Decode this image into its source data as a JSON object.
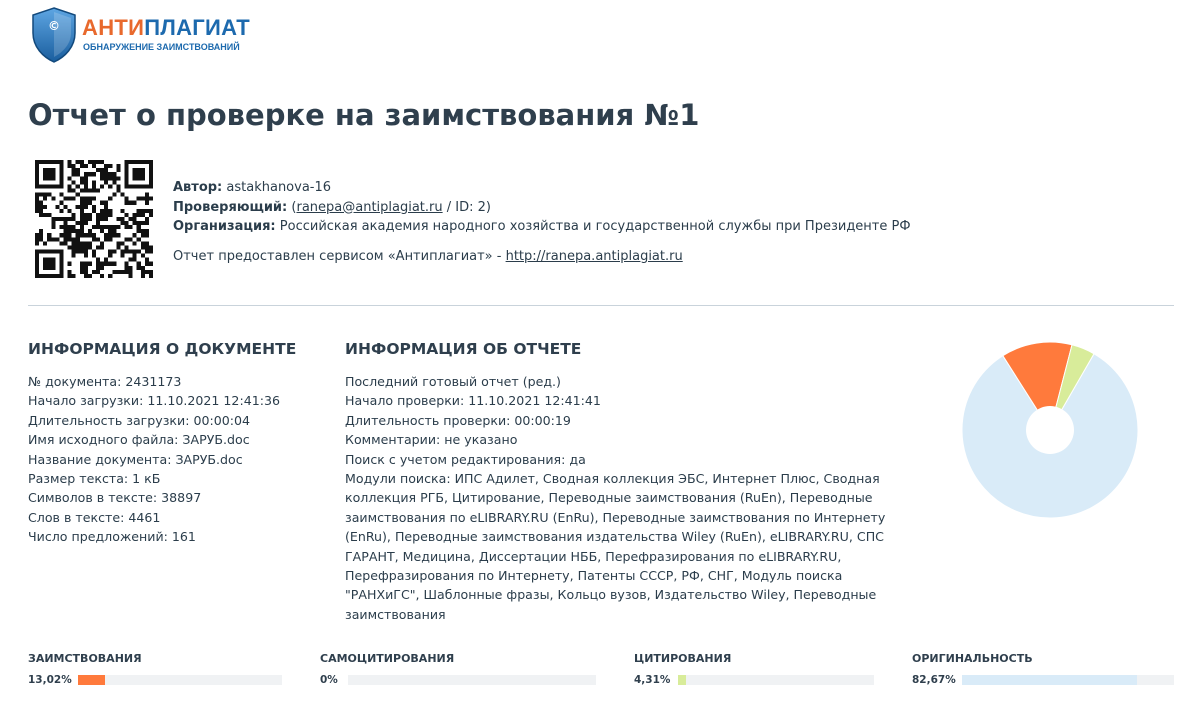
{
  "logo": {
    "brand_part1": "АНТИ",
    "brand_part2": "ПЛАГИАТ",
    "tagline": "ОБНАРУЖЕНИЕ ЗАИМСТВОВАНИЙ",
    "symbol": "©"
  },
  "title": "Отчет о проверке на заимствования №1",
  "meta": {
    "author_label": "Автор:",
    "author_value": "astakhanova-16",
    "checker_label": "Проверяющий:",
    "checker_open": "(",
    "checker_email": "ranepa@antiplagiat.ru",
    "checker_rest": " / ID: 2)",
    "org_label": "Организация:",
    "org_value": "Российская академия народного хозяйства и государственной службы при Президенте РФ",
    "provided_text": "Отчет предоставлен сервисом «Антиплагиат» - ",
    "provided_link": "http://ranepa.antiplagiat.ru"
  },
  "doc_info": {
    "title": "ИНФОРМАЦИЯ О ДОКУМЕНТЕ",
    "lines": [
      "№ документа: 2431173",
      "Начало загрузки: 11.10.2021 12:41:36",
      "Длительность загрузки: 00:00:04",
      "Имя исходного файла: ЗАРУБ.doc",
      "Название документа: ЗАРУБ.doc",
      "Размер текста: 1 кБ",
      "Символов в тексте: 38897",
      "Слов в тексте: 4461",
      "Число предложений: 161"
    ]
  },
  "report_info": {
    "title": "ИНФОРМАЦИЯ ОБ ОТЧЕТЕ",
    "lines": [
      "Последний готовый отчет (ред.)",
      "Начало проверки: 11.10.2021 12:41:41",
      "Длительность проверки: 00:00:19",
      "Комментарии: не указано",
      "Поиск с учетом редактирования: да",
      "Модули поиска: ИПС Адилет, Сводная коллекция ЭБС, Интернет Плюс, Сводная коллекция РГБ, Цитирование, Переводные заимствования (RuEn), Переводные заимствования по eLIBRARY.RU (EnRu), Переводные заимствования по Интернету (EnRu), Переводные заимствования издательства Wiley (RuEn), eLIBRARY.RU, СПС ГАРАНТ, Медицина, Диссертации НББ, Перефразирования по eLIBRARY.RU, Перефразирования по Интернету, Патенты СССР, РФ, СНГ, Модуль поиска \"РАНХиГС\", Шаблонные фразы, Кольцо вузов, Издательство Wiley, Переводные заимствования"
    ]
  },
  "metrics": [
    {
      "label": "ЗАИМСТВОВАНИЯ",
      "value_text": "13,02%",
      "value": 13.02,
      "color": "#ff7a3c"
    },
    {
      "label": "САМОЦИТИРОВАНИЯ",
      "value_text": "0%",
      "value": 0,
      "color": "#f6cf3a"
    },
    {
      "label": "ЦИТИРОВАНИЯ",
      "value_text": "4,31%",
      "value": 4.31,
      "color": "#d8ec9a"
    },
    {
      "label": "ОРИГИНАЛЬНОСТЬ",
      "value_text": "82,67%",
      "value": 82.67,
      "color": "#d9ebf8"
    }
  ],
  "chart_data": {
    "type": "pie",
    "slices": [
      {
        "value": 82.67,
        "color": "#d9ebf8"
      },
      {
        "value": 13.02,
        "color": "#ff7a3c"
      },
      {
        "value": 0,
        "color": "#f6cf3a"
      },
      {
        "value": 4.31,
        "color": "#d8ec9a"
      }
    ],
    "donut_hole": true,
    "start_angle_deg": -60,
    "direction": "clockwise"
  }
}
